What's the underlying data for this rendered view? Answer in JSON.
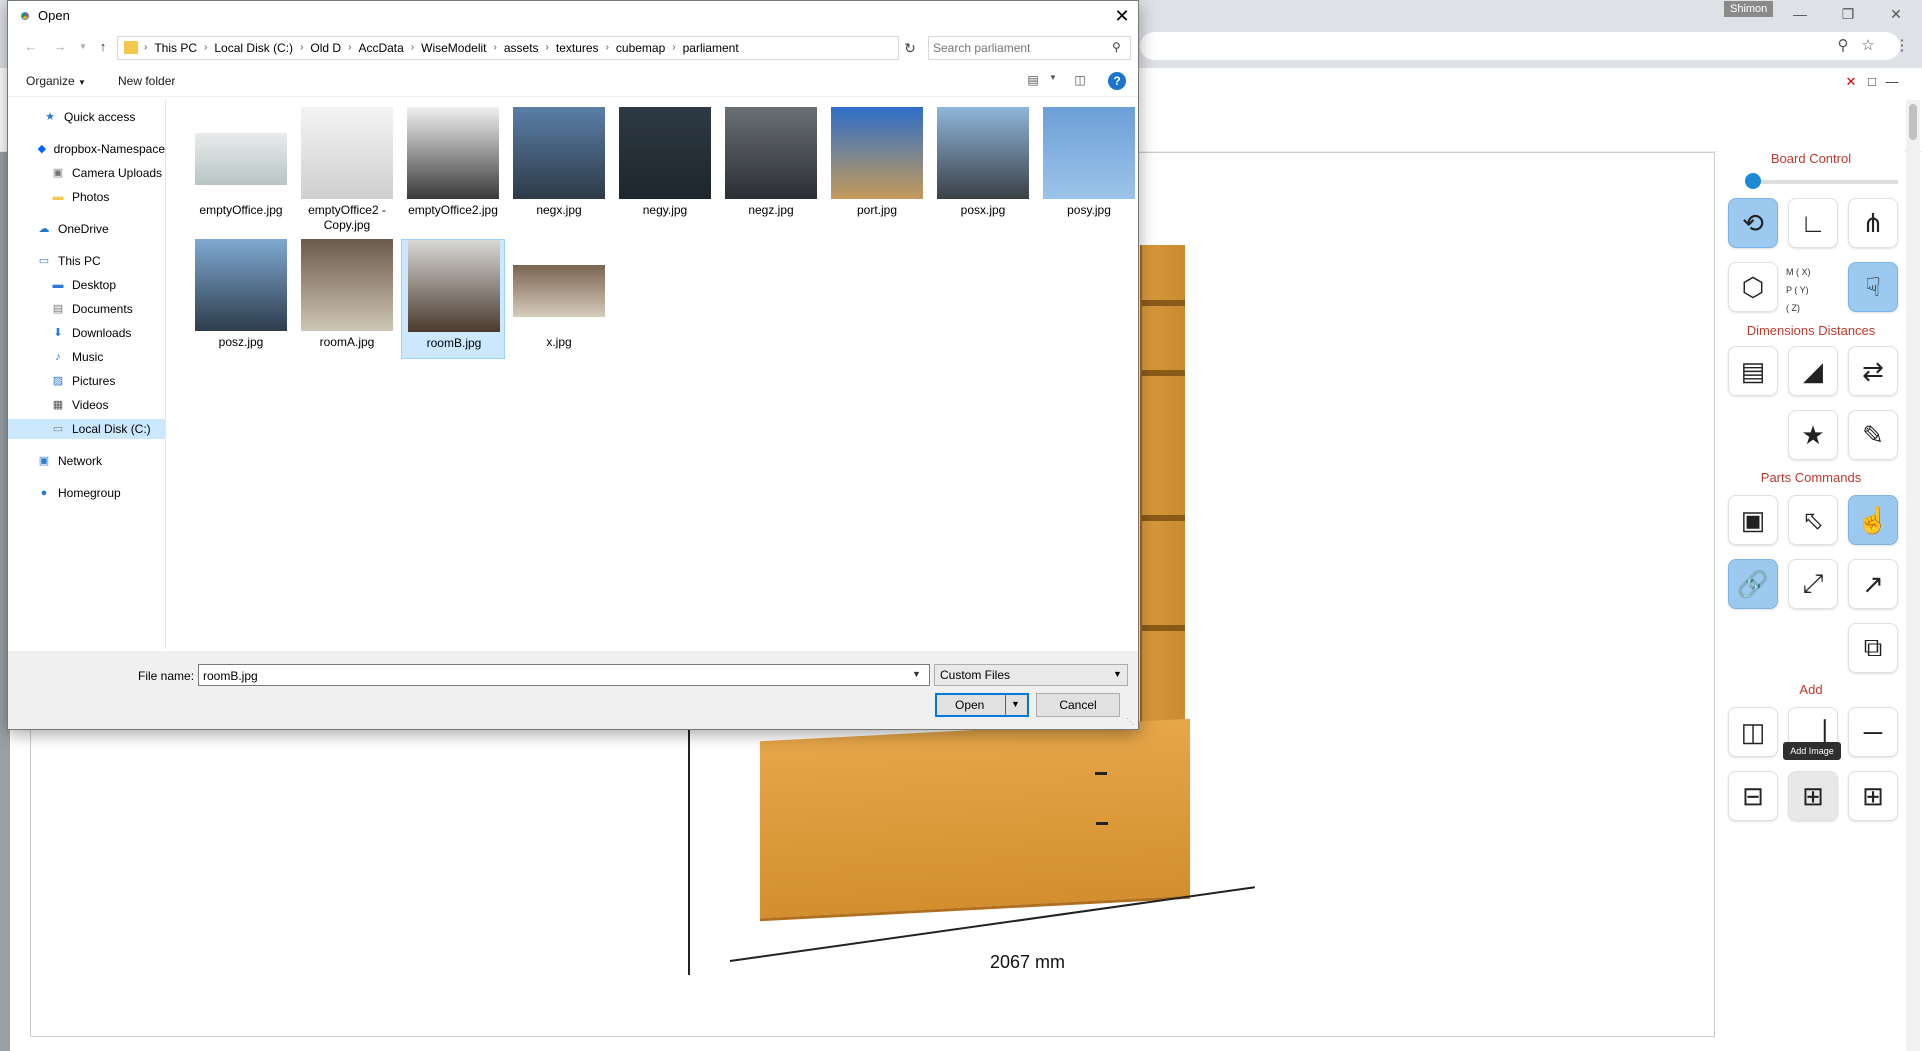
{
  "browser": {
    "user": "Shimon",
    "controls": [
      "—",
      "❐",
      "✕"
    ],
    "address_icons": [
      "search-icon",
      "star-icon",
      "menu-icon"
    ]
  },
  "app": {
    "window_controls": [
      "✕",
      "□",
      "—"
    ],
    "panel": {
      "board_control": "Board Control",
      "dimensions_distances": "Dimensions Distances",
      "parts_commands": "Parts Commands",
      "add": "Add",
      "checks": [
        "M ( X)",
        "P ( Y)",
        "( Z)"
      ],
      "tooltip": "Add Image"
    },
    "dimension_label": "2067 mm"
  },
  "dialog": {
    "title": "Open",
    "close": "✕",
    "breadcrumb": [
      "This PC",
      "Local Disk (C:)",
      "Old D",
      "AccData",
      "WiseModelit",
      "assets",
      "textures",
      "cubemap",
      "parliament"
    ],
    "search_placeholder": "Search parliament",
    "toolbar": {
      "organize": "Organize",
      "new_folder": "New folder",
      "help": "?"
    },
    "nav": [
      {
        "label": "Quick access",
        "icon": "star-icon"
      },
      {
        "label": "dropbox-Namespace",
        "icon": "dropbox-icon"
      },
      {
        "label": "Camera Uploads",
        "icon": "camera-folder-icon"
      },
      {
        "label": "Photos",
        "icon": "folder-icon"
      },
      {
        "label": "OneDrive",
        "icon": "cloud-icon"
      },
      {
        "label": "This PC",
        "icon": "computer-icon"
      },
      {
        "label": "Desktop",
        "icon": "desktop-icon"
      },
      {
        "label": "Documents",
        "icon": "documents-icon"
      },
      {
        "label": "Downloads",
        "icon": "download-icon"
      },
      {
        "label": "Music",
        "icon": "music-icon"
      },
      {
        "label": "Pictures",
        "icon": "pictures-icon"
      },
      {
        "label": "Videos",
        "icon": "videos-icon"
      },
      {
        "label": "Local Disk (C:)",
        "icon": "disk-icon"
      },
      {
        "label": "Network",
        "icon": "network-icon"
      },
      {
        "label": "Homegroup",
        "icon": "homegroup-icon"
      }
    ],
    "files": [
      {
        "name": "emptyOffice.jpg",
        "colors": [
          "#e9ecec",
          "#b8c4c4"
        ]
      },
      {
        "name": "emptyOffice2 - Copy.jpg",
        "colors": [
          "#f4f4f4",
          "#cfcfcf"
        ]
      },
      {
        "name": "emptyOffice2.jpg",
        "colors": [
          "#f0f0f0",
          "#3a3a3a"
        ]
      },
      {
        "name": "negx.jpg",
        "colors": [
          "#5a7fa8",
          "#2d3a46"
        ]
      },
      {
        "name": "negy.jpg",
        "colors": [
          "#2e3a44",
          "#1d262d"
        ]
      },
      {
        "name": "negz.jpg",
        "colors": [
          "#6a6f74",
          "#2b2f33"
        ]
      },
      {
        "name": "port.jpg",
        "colors": [
          "#2f6ec8",
          "#c49b5a"
        ]
      },
      {
        "name": "posx.jpg",
        "colors": [
          "#8fb6dc",
          "#3a4046"
        ]
      },
      {
        "name": "posy.jpg",
        "colors": [
          "#6c9fd6",
          "#9cc4ea"
        ]
      },
      {
        "name": "posz.jpg",
        "colors": [
          "#7fa9d2",
          "#2e3d4c"
        ]
      },
      {
        "name": "roomA.jpg",
        "colors": [
          "#6b5a4a",
          "#cfc6b6"
        ]
      },
      {
        "name": "roomB.jpg",
        "colors": [
          "#d8d8d6",
          "#4a3a2e"
        ]
      },
      {
        "name": "x.jpg",
        "colors": [
          "#7a6452",
          "#d6ccbc"
        ]
      }
    ],
    "selected_file": "roomB.jpg",
    "file_name_label": "File name:",
    "file_name_value": "roomB.jpg",
    "file_type": "Custom Files",
    "open_button": "Open",
    "cancel_button": "Cancel"
  }
}
